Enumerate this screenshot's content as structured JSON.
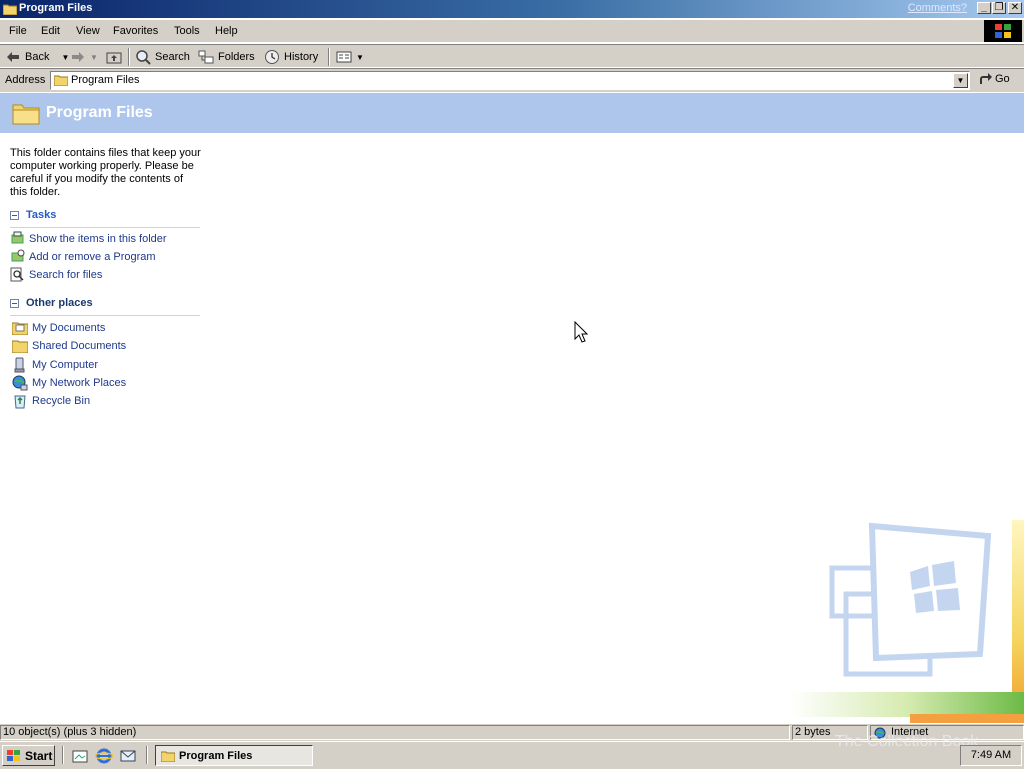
{
  "window": {
    "title": "Program Files",
    "comments_link": "Comments?"
  },
  "menu": [
    "File",
    "Edit",
    "View",
    "Favorites",
    "Tools",
    "Help"
  ],
  "toolbar": {
    "back": "Back",
    "search": "Search",
    "folders": "Folders",
    "history": "History"
  },
  "address": {
    "label": "Address",
    "value": "Program Files",
    "go": "Go"
  },
  "header": {
    "title": "Program Files"
  },
  "left_pane": {
    "description": "This folder contains files that keep your computer working properly. Please be careful if you modify the contents of this folder.",
    "tasks": {
      "heading": "Tasks",
      "items": [
        "Show the items in this folder",
        "Add or remove a Program",
        "Search for files"
      ]
    },
    "other_places": {
      "heading": "Other places",
      "items": [
        "My Documents",
        "Shared Documents",
        "My Computer",
        "My Network Places",
        "Recycle Bin"
      ]
    }
  },
  "status": {
    "objects": "10 object(s) (plus 3 hidden)",
    "size": "2 bytes",
    "zone": "Internet"
  },
  "taskbar": {
    "start": "Start",
    "task": "Program Files",
    "clock": "7:49 AM",
    "watermark": "The Collection Book"
  },
  "colors": {
    "title_start": "#0a246a",
    "title_end": "#a6caf0",
    "header_band": "#aec6ec",
    "link": "#1e3a8a",
    "section_heading": "#215dc6"
  }
}
